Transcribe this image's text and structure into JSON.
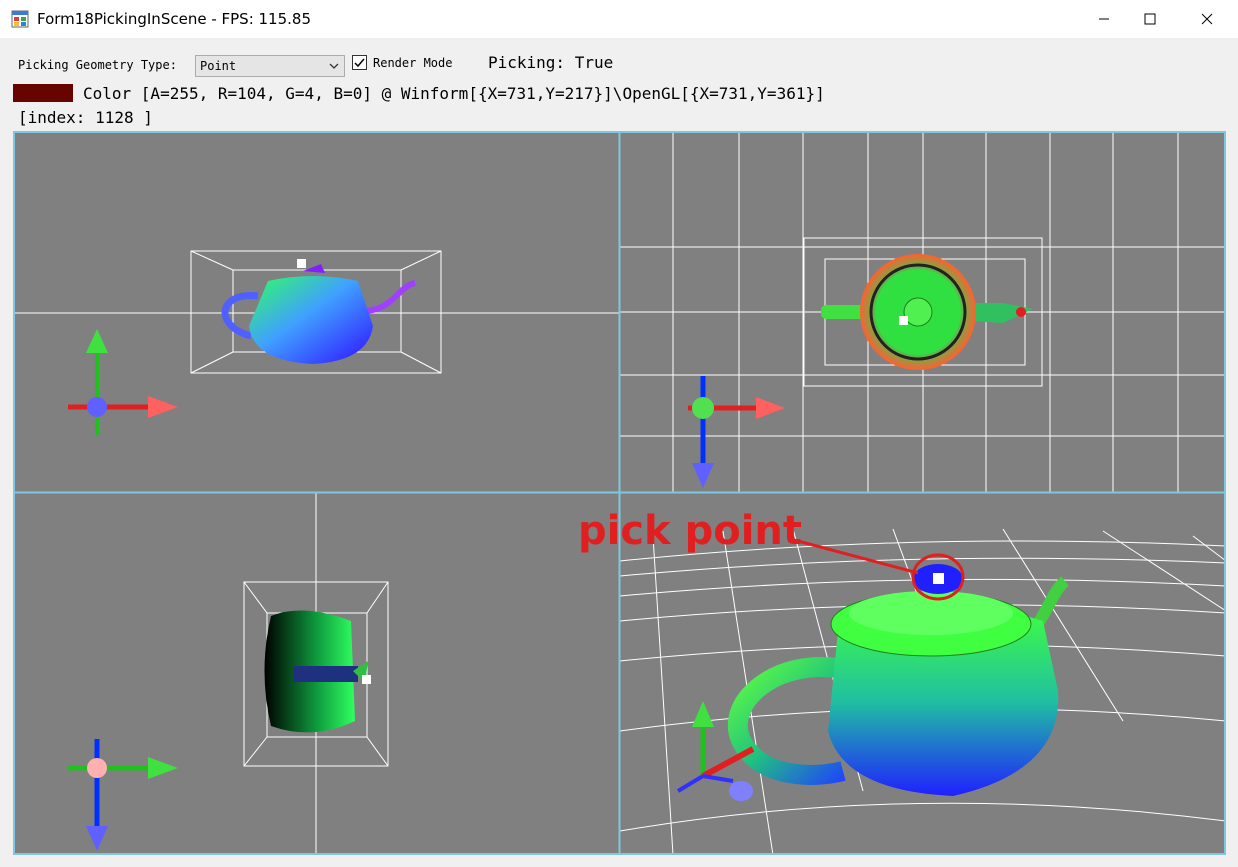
{
  "window": {
    "title": "Form18PickingInScene - FPS: 115.85"
  },
  "toolbar": {
    "geometry_label": "Picking Geometry Type:",
    "geometry_value": "Point",
    "render_mode_label": "Render Mode",
    "render_mode_checked": true,
    "picking_status": "Picking: True"
  },
  "pick_info": {
    "swatch_color": "#680400",
    "color_text": "Color [A=255, R=104, G=4, B=0] @ Winform[{X=731,Y=217}]\\OpenGL[{X=731,Y=361}]",
    "index_text": "[index: 1128 ]"
  },
  "annotation": {
    "label": "pick point",
    "color": "#e02020"
  },
  "colors": {
    "viewport_bg": "#808080",
    "viewport_border": "#7fc7e0",
    "grid": "#ffffff"
  }
}
